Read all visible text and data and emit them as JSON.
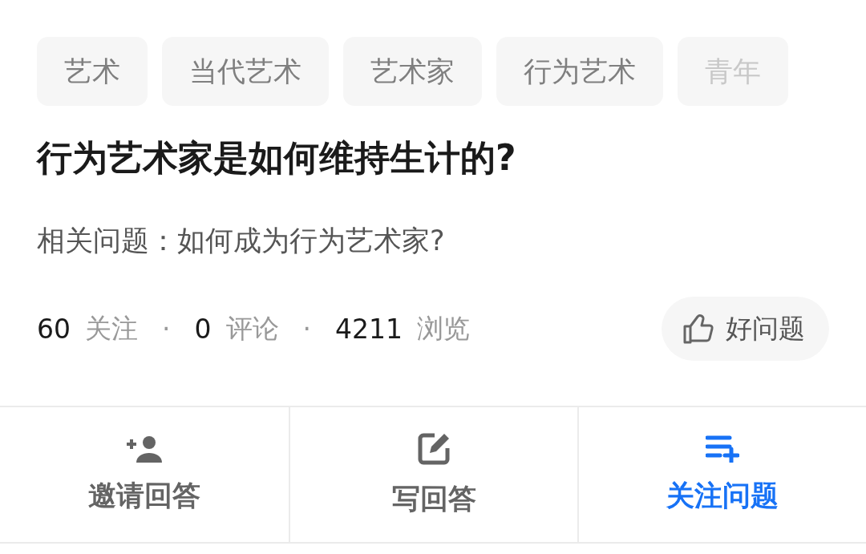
{
  "tags": [
    {
      "label": "艺术",
      "faded": false
    },
    {
      "label": "当代艺术",
      "faded": false
    },
    {
      "label": "艺术家",
      "faded": false
    },
    {
      "label": "行为艺术",
      "faded": false
    },
    {
      "label": "青年",
      "faded": true
    }
  ],
  "question": {
    "title": "行为艺术家是如何维持生计的?",
    "related": "相关问题：如何成为行为艺术家?"
  },
  "stats": {
    "separator": "·",
    "items": [
      {
        "count": "60",
        "label": "关注"
      },
      {
        "count": "0",
        "label": "评论"
      },
      {
        "count": "4211",
        "label": "浏览"
      }
    ]
  },
  "good_question_button": {
    "label": "好问题"
  },
  "actions": [
    {
      "kind": "invite",
      "label": "邀请回答",
      "active": false
    },
    {
      "kind": "write",
      "label": "写回答",
      "active": false
    },
    {
      "kind": "follow",
      "label": "关注问题",
      "active": true
    }
  ]
}
